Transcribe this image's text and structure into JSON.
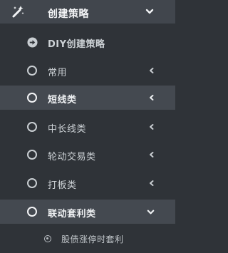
{
  "menu": {
    "header": {
      "label": "创建策略",
      "icon": "magic-wand-icon",
      "expanded": true
    },
    "items": [
      {
        "label": "DIY创建策略",
        "icon": "arrow-right-circle-icon",
        "bold": true,
        "chevron": null
      },
      {
        "label": "常用",
        "icon": "circle-icon",
        "bold": false,
        "chevron": "left"
      },
      {
        "label": "短线类",
        "icon": "circle-icon",
        "bold": true,
        "chevron": "left",
        "highlighted": true
      },
      {
        "label": "中长线类",
        "icon": "circle-icon",
        "bold": false,
        "chevron": "left"
      },
      {
        "label": "轮动交易类",
        "icon": "circle-icon",
        "bold": false,
        "chevron": "left"
      },
      {
        "label": "打板类",
        "icon": "circle-icon",
        "bold": false,
        "chevron": "left"
      },
      {
        "label": "联动套利类",
        "icon": "circle-icon",
        "bold": true,
        "chevron": "down",
        "highlighted": true
      }
    ],
    "subitems": [
      {
        "label": "股债涨停时套利",
        "icon": "dot-circle-icon"
      }
    ]
  },
  "colors": {
    "background": "#2f3338",
    "highlight": "#444950",
    "header": "#41464d",
    "text": "#cdd2d6"
  }
}
